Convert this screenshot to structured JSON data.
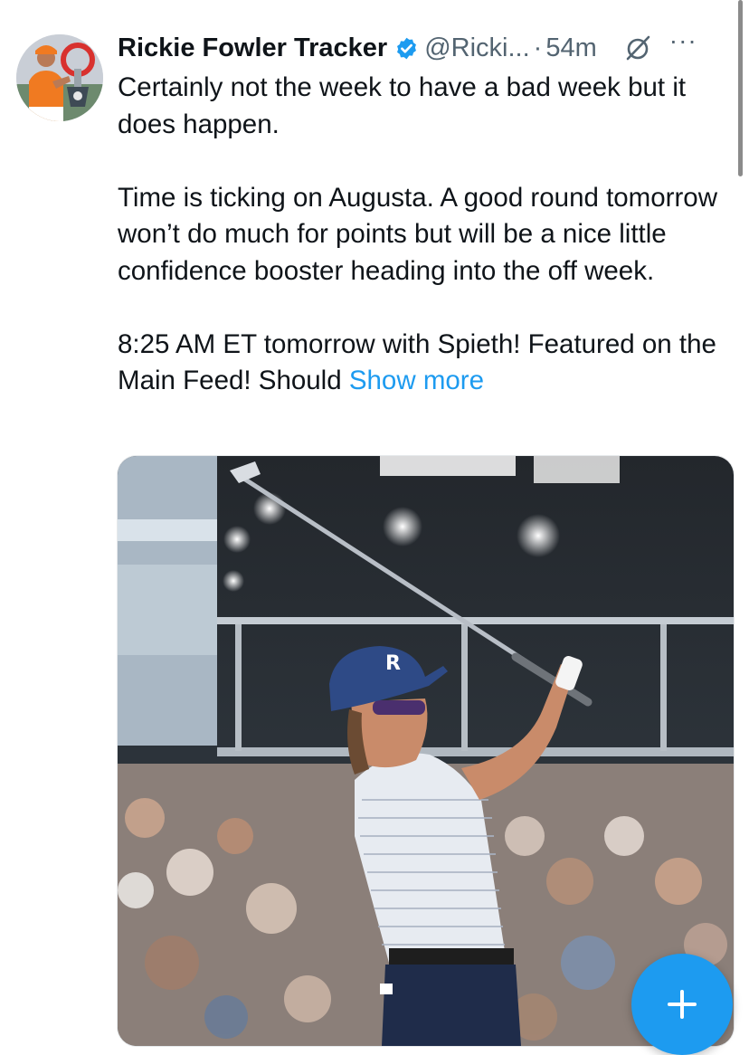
{
  "tweet": {
    "display_name": "Rickie Fowler Tracker",
    "handle": "@Ricki...",
    "separator": "·",
    "time": "54m",
    "body": {
      "line1": "Certainly not the week to have a bad week but it does happen.",
      "line2": "Time is ticking on Augusta. A good round tomorrow won’t do much for points but will be a nice little confidence booster heading into the off week.",
      "line3": "8:25 AM ET tomorrow with Spieth! Featured on the Main Feed! Should",
      "show_more": "Show more"
    },
    "more_label": "···",
    "media": {
      "description_icon": "golfer-photo"
    }
  },
  "icons": {
    "verified": "verified-badge-icon",
    "grok": "grok-icon",
    "more": "more-icon",
    "compose": "plus-icon"
  },
  "colors": {
    "accent": "#1d9bf0",
    "text": "#0f1419",
    "secondary": "#536471",
    "background": "#ffffff"
  }
}
